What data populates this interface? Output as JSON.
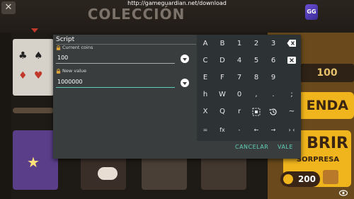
{
  "overlay": {
    "url": "http://gameguardian.net/download",
    "game_title": "COLECCIÓN",
    "close_icon": "close-icon",
    "right_panel": {
      "count": "100",
      "button_text_1": "ENDA",
      "button_text_2": "BRIR",
      "surprise_label": "SORPRESA",
      "price": "200"
    }
  },
  "dialog": {
    "title": "Script",
    "fields": [
      {
        "label": "Current coins",
        "value": "100"
      },
      {
        "label": "New value",
        "value": "1000000"
      }
    ],
    "cancel_label": "CANCELAR",
    "ok_label": "VALE"
  },
  "keypad": {
    "keys": [
      [
        "A",
        "B",
        "1",
        "2",
        "3",
        "backspace-icon"
      ],
      [
        "C",
        "D",
        "4",
        "5",
        "6",
        "clear-icon"
      ],
      [
        "E",
        "F",
        "7",
        "8",
        "9",
        ""
      ],
      [
        "h",
        "W",
        "0",
        ",",
        ".",
        ";"
      ],
      [
        "X",
        "Q",
        "r",
        "select-icon",
        "history-icon",
        "~"
      ],
      [
        "=",
        "fx",
        "-",
        "←",
        "→",
        "› ‹"
      ]
    ]
  },
  "colors": {
    "dialog_bg": "#3a3d3e",
    "keypad_bg": "#2d3235",
    "accent": "#5fd1b8"
  }
}
